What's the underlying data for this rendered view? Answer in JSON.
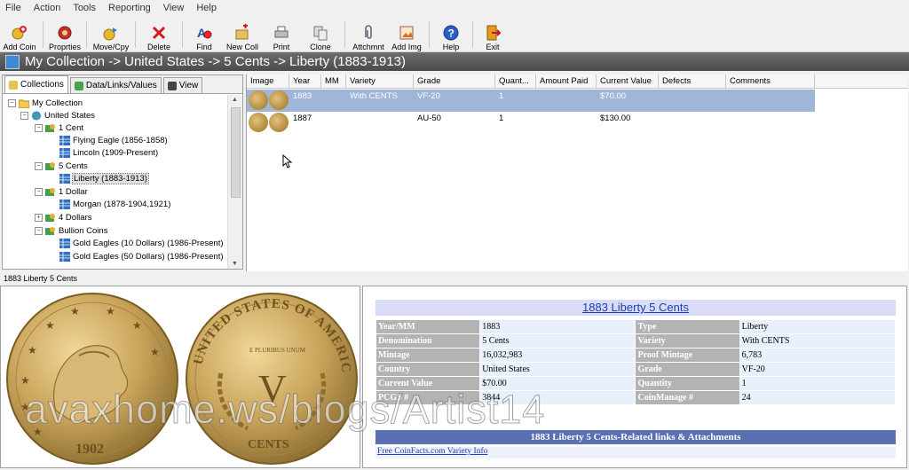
{
  "menu": [
    "File",
    "Action",
    "Tools",
    "Reporting",
    "View",
    "Help"
  ],
  "toolbar": {
    "add_coin": "Add Coin",
    "properties": "Proprties",
    "move_copy": "Move/Cpy",
    "delete": "Delete",
    "find": "Find",
    "new_coll": "New Coll",
    "print": "Print",
    "clone": "Clone",
    "attachment": "Attchmnt",
    "add_img": "Add Img",
    "help": "Help",
    "exit": "Exit"
  },
  "breadcrumb": "My Collection -> United States -> 5 Cents -> Liberty (1883-1913)",
  "tabs": [
    "Collections",
    "Data/Links/Values",
    "View"
  ],
  "tree": {
    "root": "My Collection",
    "country": "United States",
    "one_cent": "1 Cent",
    "flying_eagle": "Flying Eagle (1856-1858)",
    "lincoln": "Lincoln (1909-Present)",
    "five_cents": "5 Cents",
    "liberty": "Liberty (1883-1913)",
    "one_dollar": "1 Dollar",
    "morgan": "Morgan (1878-1904,1921)",
    "four_dollars": "4 Dollars",
    "bullion": "Bullion Coins",
    "gold10": "Gold Eagles (10 Dollars) (1986-Present)",
    "gold50": "Gold Eagles (50 Dollars) (1986-Present)"
  },
  "grid": {
    "headers": [
      "Image",
      "Year",
      "MM",
      "Variety",
      "Grade",
      "Quant...",
      "Amount Paid",
      "Current Value",
      "Defects",
      "Comments"
    ],
    "rows": [
      {
        "year": "1883",
        "mm": "",
        "variety": "With CENTS",
        "grade": "VF-20",
        "quantity": "1",
        "amount_paid": "",
        "current_value": "$70.00",
        "defects": "",
        "comments": ""
      },
      {
        "year": "1887",
        "mm": "",
        "variety": "",
        "grade": "AU-50",
        "quantity": "1",
        "amount_paid": "",
        "current_value": "$130.00",
        "defects": "",
        "comments": ""
      }
    ]
  },
  "status": "1883 Liberty  5 Cents",
  "detail": {
    "title": "1883 Liberty 5 Cents",
    "rows": [
      {
        "l1": "Year/MM",
        "v1": "1883",
        "l2": "Type",
        "v2": "Liberty"
      },
      {
        "l1": "Denomination",
        "v1": "5 Cents",
        "l2": "Variety",
        "v2": "With CENTS"
      },
      {
        "l1": "Mintage",
        "v1": "16,032,983",
        "l2": "Proof Mintage",
        "v2": "6,783"
      },
      {
        "l1": "Country",
        "v1": "United States",
        "l2": "Grade",
        "v2": "VF-20"
      },
      {
        "l1": "Current Value",
        "v1": "$70.00",
        "l2": "Quantity",
        "v2": "1"
      },
      {
        "l1": "PCGS #",
        "v1": "3844",
        "l2": "CoinManage #",
        "v2": "24"
      }
    ],
    "section": "1883 Liberty 5 Cents-Related links & Attachments",
    "link": "Free CoinFacts.com Variety Info"
  },
  "coin": {
    "obverse_date": "1902",
    "reverse_legend": "UNITED STATES OF AMERICA",
    "reverse_motto": "E PLURIBUS UNUM",
    "reverse_numeral": "V",
    "reverse_denomination": "CENTS"
  },
  "watermark": "avaxhome.ws/blogs/Artist14",
  "colors": {
    "selection": "#9fb6d9",
    "link": "#1a3fb8",
    "detail_label": "#b3b3b3",
    "section_bar": "#5b6fb3"
  }
}
